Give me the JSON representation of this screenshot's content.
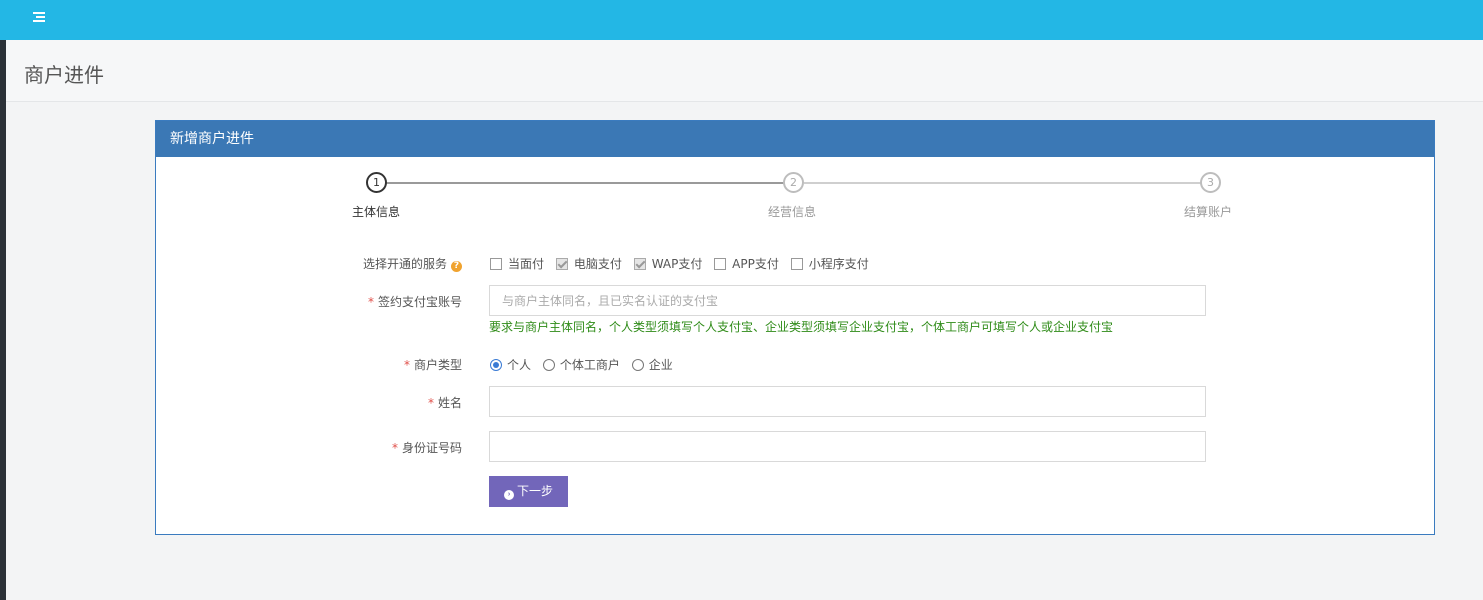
{
  "page": {
    "title": "商户进件"
  },
  "panel": {
    "heading": "新增商户进件"
  },
  "steps": [
    {
      "number": "1",
      "label": "主体信息",
      "active": true
    },
    {
      "number": "2",
      "label": "经营信息",
      "active": false
    },
    {
      "number": "3",
      "label": "结算账户",
      "active": false
    }
  ],
  "form": {
    "services": {
      "label": "选择开通的服务",
      "help_icon": "?",
      "options": [
        {
          "label": "当面付",
          "checked": false
        },
        {
          "label": "电脑支付",
          "checked": true
        },
        {
          "label": "WAP支付",
          "checked": true
        },
        {
          "label": "APP支付",
          "checked": false
        },
        {
          "label": "小程序支付",
          "checked": false
        }
      ]
    },
    "alipay_account": {
      "required_mark": "*",
      "label": "签约支付宝账号",
      "placeholder": "与商户主体同名，且已实名认证的支付宝",
      "value": "",
      "hint": "要求与商户主体同名，个人类型须填写个人支付宝、企业类型须填写企业支付宝，个体工商户可填写个人或企业支付宝"
    },
    "merchant_type": {
      "required_mark": "*",
      "label": "商户类型",
      "options": [
        {
          "label": "个人",
          "checked": true
        },
        {
          "label": "个体工商户",
          "checked": false
        },
        {
          "label": "企业",
          "checked": false
        }
      ]
    },
    "name": {
      "required_mark": "*",
      "label": "姓名",
      "value": ""
    },
    "id_number": {
      "required_mark": "*",
      "label": "身份证号码",
      "value": ""
    },
    "next_button": {
      "icon": "›",
      "label": "下一步"
    }
  },
  "colors": {
    "topbar": "#23b7e5",
    "panel_heading": "#3b78b5",
    "next_button": "#7266ba",
    "hint_text": "#2e8b17",
    "required": "#e0504a"
  }
}
